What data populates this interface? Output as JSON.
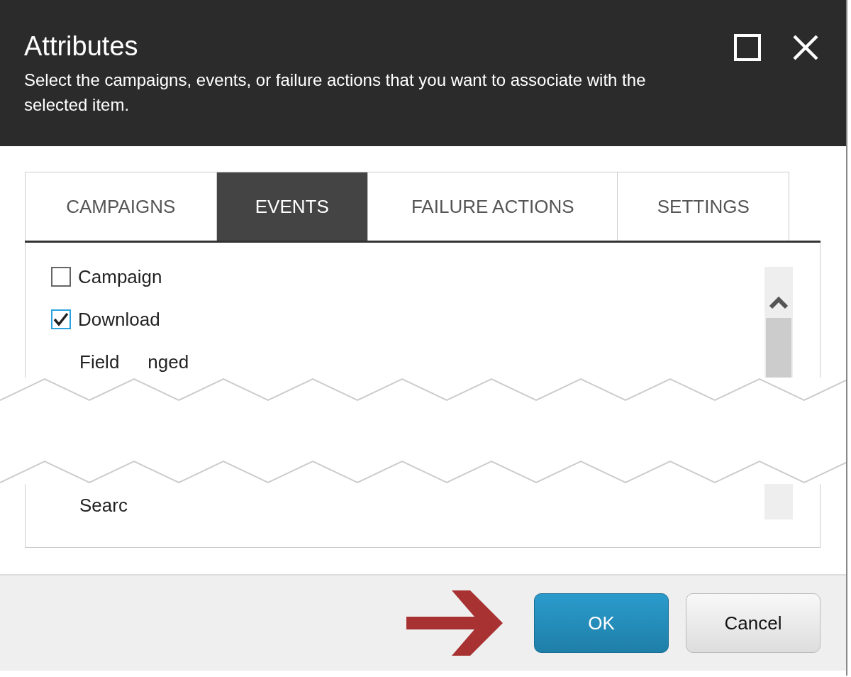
{
  "dialog": {
    "title": "Attributes",
    "subtitle": "Select the campaigns, events, or failure actions that you want to associate with the selected item."
  },
  "tabs": [
    {
      "label": "CAMPAIGNS",
      "selected": false
    },
    {
      "label": "EVENTS",
      "selected": true
    },
    {
      "label": "FAILURE ACTIONS",
      "selected": false
    },
    {
      "label": "SETTINGS",
      "selected": false
    }
  ],
  "events": [
    {
      "kind": "checkbox",
      "label": "Campaign",
      "checked": false
    },
    {
      "kind": "checkbox",
      "label": "Download",
      "checked": true
    },
    {
      "kind": "fragment",
      "parts": [
        "Field",
        "nged"
      ]
    },
    {
      "kind": "tear"
    },
    {
      "kind": "fragment",
      "parts": [
        "Searc"
      ]
    }
  ],
  "buttons": [
    {
      "label": "OK",
      "kind": "primary"
    },
    {
      "label": "Cancel",
      "kind": "secondary"
    }
  ]
}
